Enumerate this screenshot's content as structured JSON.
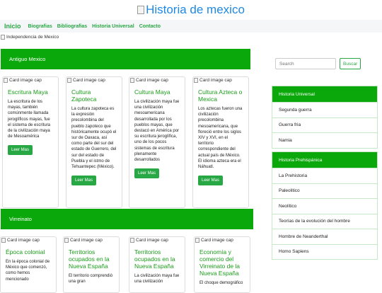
{
  "brand": {
    "title": "Historia de mexico"
  },
  "nav": {
    "home": "Inicio",
    "links": [
      "Biografias",
      "Bibliografias",
      "Historia Universal",
      "Contacto"
    ]
  },
  "hero": {
    "alt": "Independencia de Mexico"
  },
  "sections": {
    "antiguo": "Antiguo Mexico",
    "virreinato": "Virreinato"
  },
  "card_cap": "Card image cap",
  "cards_antiguo": [
    {
      "title": "Escritura Maya",
      "text": "La escritura de los mayas, también comúnmente llamada jeroglíficos mayas, fue el sistema de escritura de la civilización maya de Mesoamérica",
      "button": "Leer Mas"
    },
    {
      "title": "Cultura Zapoteca",
      "text": "La cultura zapoteca es la expresión precolombina del pueblo zapoteco que históricamente ocupó el sur de Oaxaca, así como parte del sur del estado de Guerrero, del sur del estado de Puebla y el istmo de Tehuantepec (México).",
      "button": "Leer Mas"
    },
    {
      "title": "Cultura Maya",
      "text": "La civilización maya fue una civilización mesoamericana desarrollada por los pueblos mayas, que destacó en América por su escritura jeroglífica, uno de los pocos sistemas de escritura plenamente desarrollados",
      "button": "Leer Mas"
    },
    {
      "title": "Cultura Azteca o Mexica",
      "text": "Los aztecas fueron una civilización precolombina mesoamericana, que floreció entre los siglos XIV y XVI, en el territorio correspondiente del actual país de México. El idioma azteca era el Náhuatl.",
      "button": "Leer Mas"
    }
  ],
  "cards_virreinato": [
    {
      "title": "Época colonial",
      "text": "En la época colonial de México que comenzó, como hemos mencionado"
    },
    {
      "title": "Territorios ocupados en la Nueva España",
      "text": "El territorio comprendió una gran"
    },
    {
      "title": "Territorios ocupados en la Nueva España",
      "text": "La civilización maya fue una civilización"
    },
    {
      "title": "Economía y comercio del Virreinato de la Nueva España",
      "text": "El choque demográfico"
    }
  ],
  "search": {
    "placeholder": "Search",
    "button": "Buscar"
  },
  "sidebar": {
    "universal": {
      "title": "Historia Universal",
      "items": [
        "Segunda guerra",
        "Guerra fria",
        "Namia"
      ]
    },
    "prehispanica": {
      "title": "Historia Prehispánica",
      "items": [
        "La Prehistoria",
        "Paleolitico",
        "Neolítico",
        "Teorías de la evolución del hombre",
        "Hombre de Neanderthal",
        "Homo Sapiens"
      ]
    }
  },
  "colors": {
    "accent": "#28a745",
    "section_bg": "#0aa80a",
    "brand": "#1e88e5"
  }
}
